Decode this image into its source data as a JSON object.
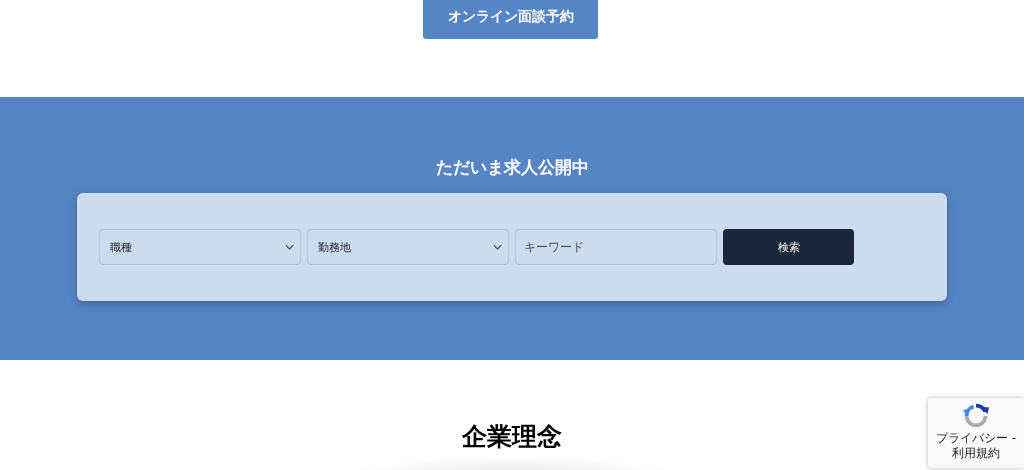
{
  "top_button": {
    "label": "オンライン面談予約"
  },
  "job_search": {
    "title": "ただいま求人公開中",
    "selects": [
      {
        "value": "職種"
      },
      {
        "value": "勤務地"
      }
    ],
    "keyword": {
      "placeholder": "キーワード"
    },
    "search_button": {
      "label": "検索"
    }
  },
  "section_heading": "企業理念",
  "recaptcha": {
    "links": "プライバシー - 利用規約"
  }
}
